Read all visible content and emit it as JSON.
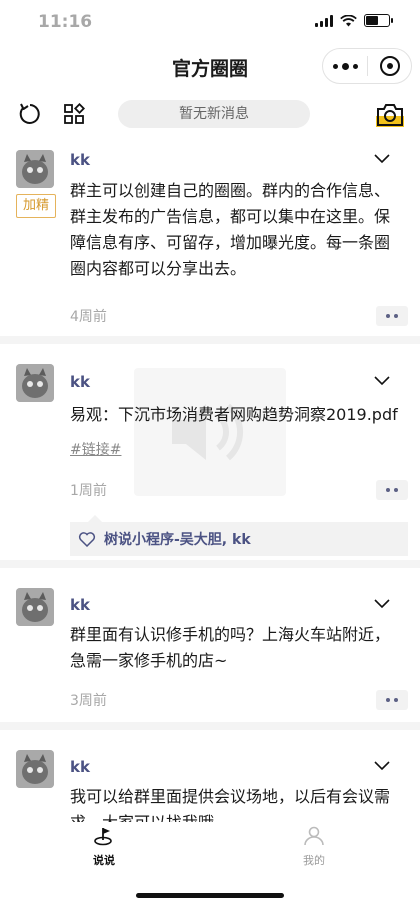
{
  "status_bar": {
    "time": "11:16"
  },
  "nav": {
    "title": "官方圈圈"
  },
  "toolbar": {
    "notice": "暂无新消息"
  },
  "posts": [
    {
      "author": "kk",
      "badge": "加精",
      "content": "群主可以创建自己的圈圈。群内的合作信息、群主发布的广告信息，都可以集中在这里。保障信息有序、可留存，增加曝光度。每一条圈圈内容都可以分享出去。",
      "time": "4周前"
    },
    {
      "author": "kk",
      "content": "易观：下沉市场消费者网购趋势洞察2019.pdf",
      "tag": "#链接#",
      "time": "1周前",
      "likes": "树说小程序-吴大胆, kk"
    },
    {
      "author": "kk",
      "content": "群里面有认识修手机的吗？上海火车站附近，急需一家修手机的店~",
      "time": "3周前"
    },
    {
      "author": "kk",
      "content": "我可以给群里面提供会议场地，以后有会议需求，大家可以找我哦"
    }
  ],
  "tabbar": {
    "tabs": [
      {
        "label": "说说",
        "active": true
      },
      {
        "label": "我的",
        "active": false
      }
    ]
  },
  "colors": {
    "author": "#4b5283",
    "badge": "#d69a2e",
    "muted": "#a8a8a8"
  }
}
